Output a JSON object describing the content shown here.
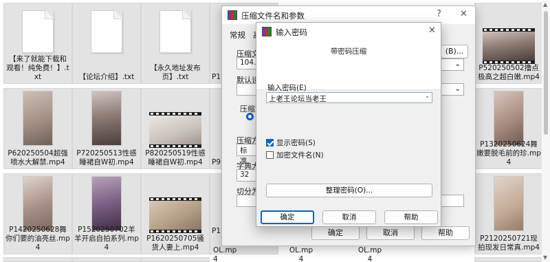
{
  "files": [
    {
      "name": "【来了就能下载和观看！纯免费！】.txt",
      "kind": "text",
      "selected": true
    },
    {
      "name": "【论坛介绍】.txt",
      "kind": "text",
      "selected": true
    },
    {
      "name": "【永久地址发布页】.txt",
      "kind": "text",
      "selected": true
    },
    {
      "name": "P1",
      "kind": "partial",
      "selected": true
    },
    {
      "name": "P520250502撸点极高之超白嫩.mp4",
      "kind": "video-film",
      "selected": true
    },
    {
      "name": "P620250504超强喷水大解禁.mp4",
      "kind": "video",
      "selected": true
    },
    {
      "name": "P720250513性感睡裙自W初.mp4",
      "kind": "video",
      "selected": true
    },
    {
      "name": "P820250519性感睡裙自W初.mp4",
      "kind": "video-film",
      "selected": true
    },
    {
      "name": "P9",
      "kind": "partial",
      "selected": true
    },
    {
      "name": "P1320250624舞嫩要脱毛前的珍.mp4",
      "kind": "video",
      "selected": true
    },
    {
      "name": "P1420250628舞你们要的油亮丝.mp4",
      "kind": "video",
      "selected": true
    },
    {
      "name": "P1520250702羊羊开启自拍系列.mp4",
      "kind": "video",
      "selected": true
    },
    {
      "name": "P1620250705骚货人妻上.mp4",
      "kind": "video-film",
      "selected": true
    },
    {
      "name": "P1",
      "kind": "partial",
      "selected": true
    },
    {
      "name": "OL.mp4",
      "kind": "partial",
      "selected": true
    },
    {
      "name": "OL.mp4",
      "kind": "partial",
      "selected": true
    },
    {
      "name": "OL.mp4",
      "kind": "partial",
      "selected": true
    },
    {
      "name": "P2120250721现拍现发日常真.mp4",
      "kind": "video",
      "selected": true
    }
  ],
  "back_dialog": {
    "title": "压缩文件名和参数",
    "help_glyph": "?",
    "close_glyph": "✕",
    "menu": [
      "常规",
      "高"
    ],
    "archive_name_label": "压缩文件",
    "archive_name_value": "104.rar",
    "browse_button": "(B)...",
    "default_settings_label": "默认设",
    "format_label": "压缩文",
    "method_label": "压缩方",
    "method_value": "标准",
    "dict_label": "字典大小",
    "dict_value": "32",
    "split_label": "切分为分",
    "ok": "确定",
    "cancel": "取消",
    "help": "帮助"
  },
  "password_dialog": {
    "title": "输入密码",
    "close_glyph": "✕",
    "subtitle": "带密码压缩",
    "enter_label": "输入密码(E)",
    "password_value": "上老王论坛当老王",
    "show_password": {
      "label": "显示密码(S)",
      "checked": true
    },
    "encrypt_names": {
      "label": "加密文件名(N)",
      "checked": false
    },
    "organize_button": "整理密码(O)...",
    "ok": "确定",
    "cancel": "取消",
    "help": "帮助"
  }
}
